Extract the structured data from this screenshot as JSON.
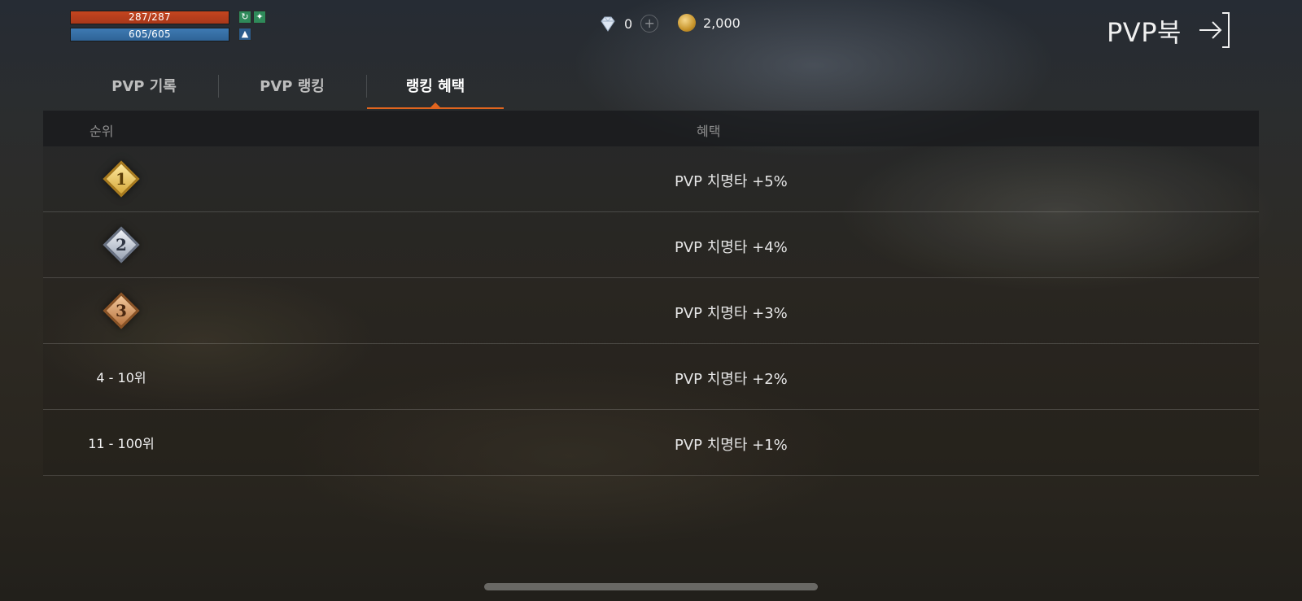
{
  "status": {
    "hp": "287/287",
    "mp": "605/605"
  },
  "currency": {
    "gems": "0",
    "gold": "2,000"
  },
  "header": {
    "title": "PVP북"
  },
  "tabs": [
    {
      "label": "PVP 기록"
    },
    {
      "label": "PVP 랭킹"
    },
    {
      "label": "랭킹 혜택"
    }
  ],
  "table": {
    "headers": {
      "rank": "순위",
      "benefit": "혜택"
    },
    "rows": [
      {
        "rank": "1",
        "benefit": "PVP 치명타 +5%"
      },
      {
        "rank": "2",
        "benefit": "PVP 치명타 +4%"
      },
      {
        "rank": "3",
        "benefit": "PVP 치명타 +3%"
      },
      {
        "rank": "4 - 10위",
        "benefit": "PVP 치명타 +2%"
      },
      {
        "rank": "11 - 100위",
        "benefit": "PVP 치명타 +1%"
      }
    ]
  },
  "colors": {
    "hp": "#c4451f",
    "mp": "#3e7ab3",
    "accent": "#e0641e",
    "gold_medal": "#d7a93a",
    "silver_medal": "#9aa4b4",
    "bronze_medal": "#b8743f"
  }
}
